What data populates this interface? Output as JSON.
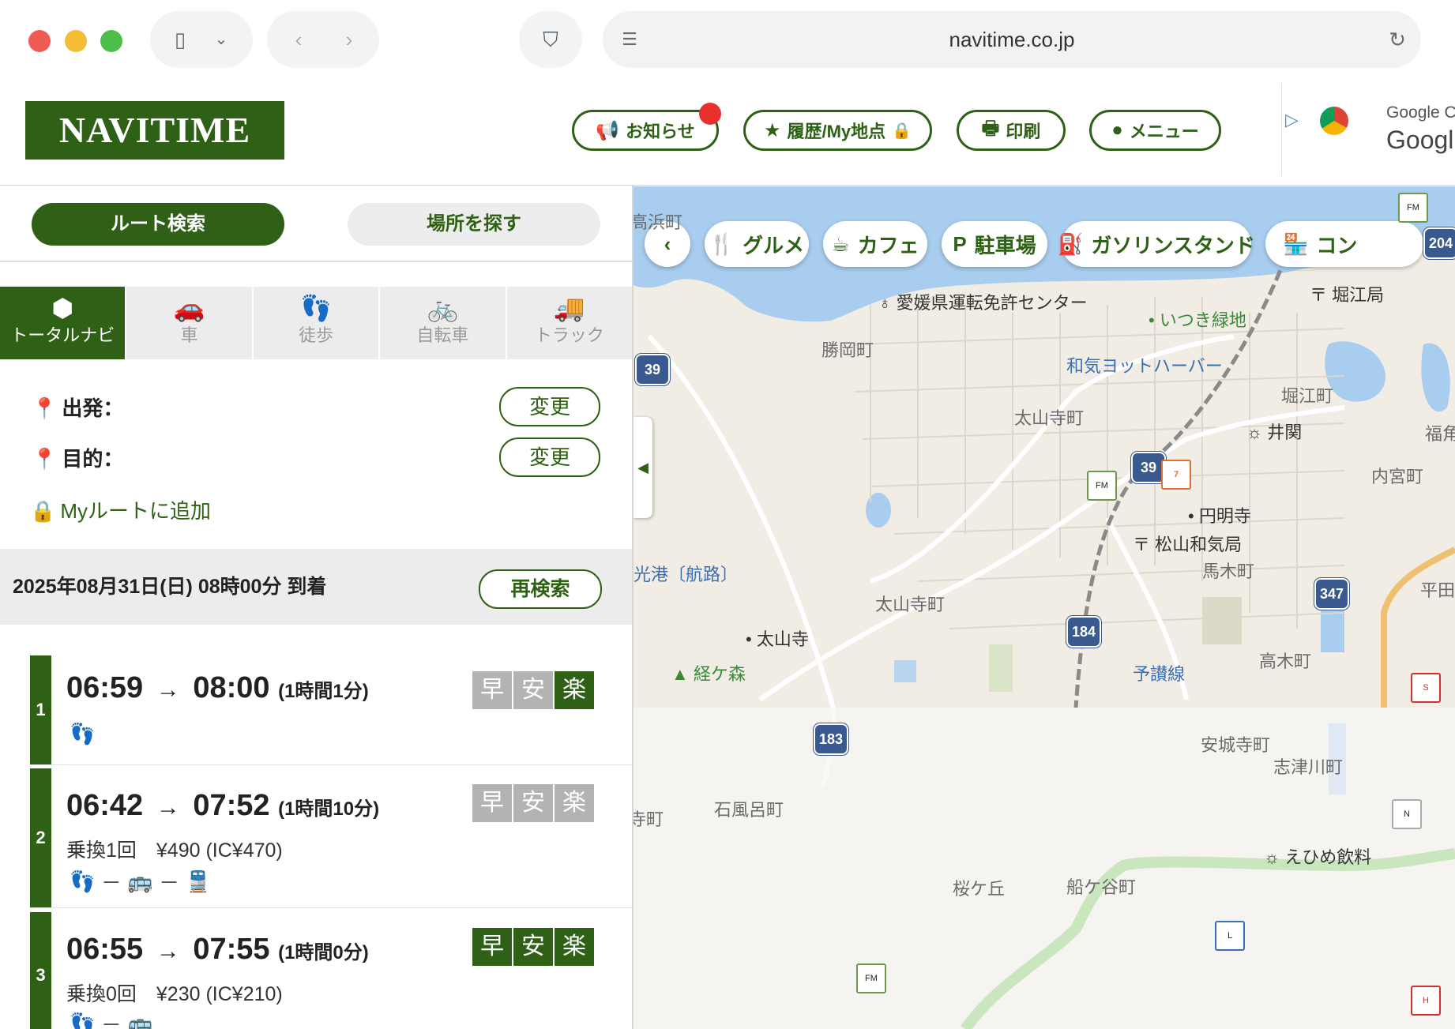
{
  "browser": {
    "url": "navitime.co.jp"
  },
  "header": {
    "logo": "NAVITIME",
    "buttons": {
      "notice": "お知らせ",
      "history": "履歴/My地点",
      "print": "印刷",
      "menu": "メニュー"
    },
    "ad": {
      "line1": "Google C",
      "line2": "Googl"
    }
  },
  "search_tabs": {
    "route": "ルート検索",
    "place": "場所を探す"
  },
  "modes": [
    {
      "label": "トータルナビ",
      "icon": "cube-icon",
      "active": true
    },
    {
      "label": "車",
      "icon": "car-icon",
      "active": false
    },
    {
      "label": "徒歩",
      "icon": "footprints-icon",
      "active": false
    },
    {
      "label": "自転車",
      "icon": "bicycle-icon",
      "active": false
    },
    {
      "label": "トラック",
      "icon": "truck-icon",
      "active": false
    }
  ],
  "origin": {
    "label": "出発：",
    "change": "変更"
  },
  "destination": {
    "label": "目的：",
    "change": "変更"
  },
  "my_route": "Myルートに追加",
  "date_bar": {
    "text": "2025年08月31日(日) 08時00分 到着",
    "research": "再検索"
  },
  "routes": [
    {
      "num": "1",
      "depart": "06:59",
      "arrow": "→",
      "arrive": "08:00",
      "duration": "(1時間1分)",
      "info": "",
      "legs": "👣",
      "badges": [
        "早",
        "安",
        "楽"
      ],
      "badges_on": [
        false,
        false,
        true
      ]
    },
    {
      "num": "2",
      "depart": "06:42",
      "arrow": "→",
      "arrive": "07:52",
      "duration": "(1時間10分)",
      "info": "乗換1回　¥490 (IC¥470)",
      "legs": "👣 ─ 🚌 ─ 🚆",
      "badges": [
        "早",
        "安",
        "楽"
      ],
      "badges_on": [
        false,
        false,
        false
      ]
    },
    {
      "num": "3",
      "depart": "06:55",
      "arrow": "→",
      "arrive": "07:55",
      "duration": "(1時間0分)",
      "info": "乗換0回　¥230 (IC¥210)",
      "legs": "👣 ─ 🚌",
      "badges": [
        "早",
        "安",
        "楽"
      ],
      "badges_on": [
        true,
        true,
        true
      ]
    }
  ],
  "map": {
    "categories": {
      "gourmet": "グルメ",
      "cafe": "カフェ",
      "parking": "駐車場",
      "gas": "ガソリンスタンド",
      "convenience": "コン"
    },
    "labels": {
      "takahama": "高浜町",
      "license_center": "愛媛県運転免許センター",
      "horie_post": "堀江局",
      "itsuki": "いつき緑地",
      "katsuoka": "勝岡町",
      "wake_harbor": "和気ヨットハーバー",
      "horie_town": "堀江町",
      "taisanji_town": "太山寺町",
      "iseki": "井関",
      "fuku": "福角",
      "naiguuji": "内宮町",
      "enmyoji": "円明寺",
      "matsuyama_wake": "松山和気局",
      "umaki": "馬木町",
      "hirata": "平田",
      "port": "光港〔航路〕",
      "taisanji_town2": "太山寺町",
      "taisanji": "太山寺",
      "kyogamori": "経ケ森",
      "yosan": "予讃線",
      "takaki": "高木町",
      "anjoji": "安城寺町",
      "shizugawa": "志津川町",
      "ishifuro": "石風呂町",
      "jicho": "寺町",
      "ehime_drink": "えひめ飲料",
      "sakuragaoka": "桜ケ丘",
      "funegaya": "船ケ谷町"
    },
    "road_numbers": [
      "39",
      "39",
      "204",
      "347",
      "184",
      "183"
    ]
  }
}
